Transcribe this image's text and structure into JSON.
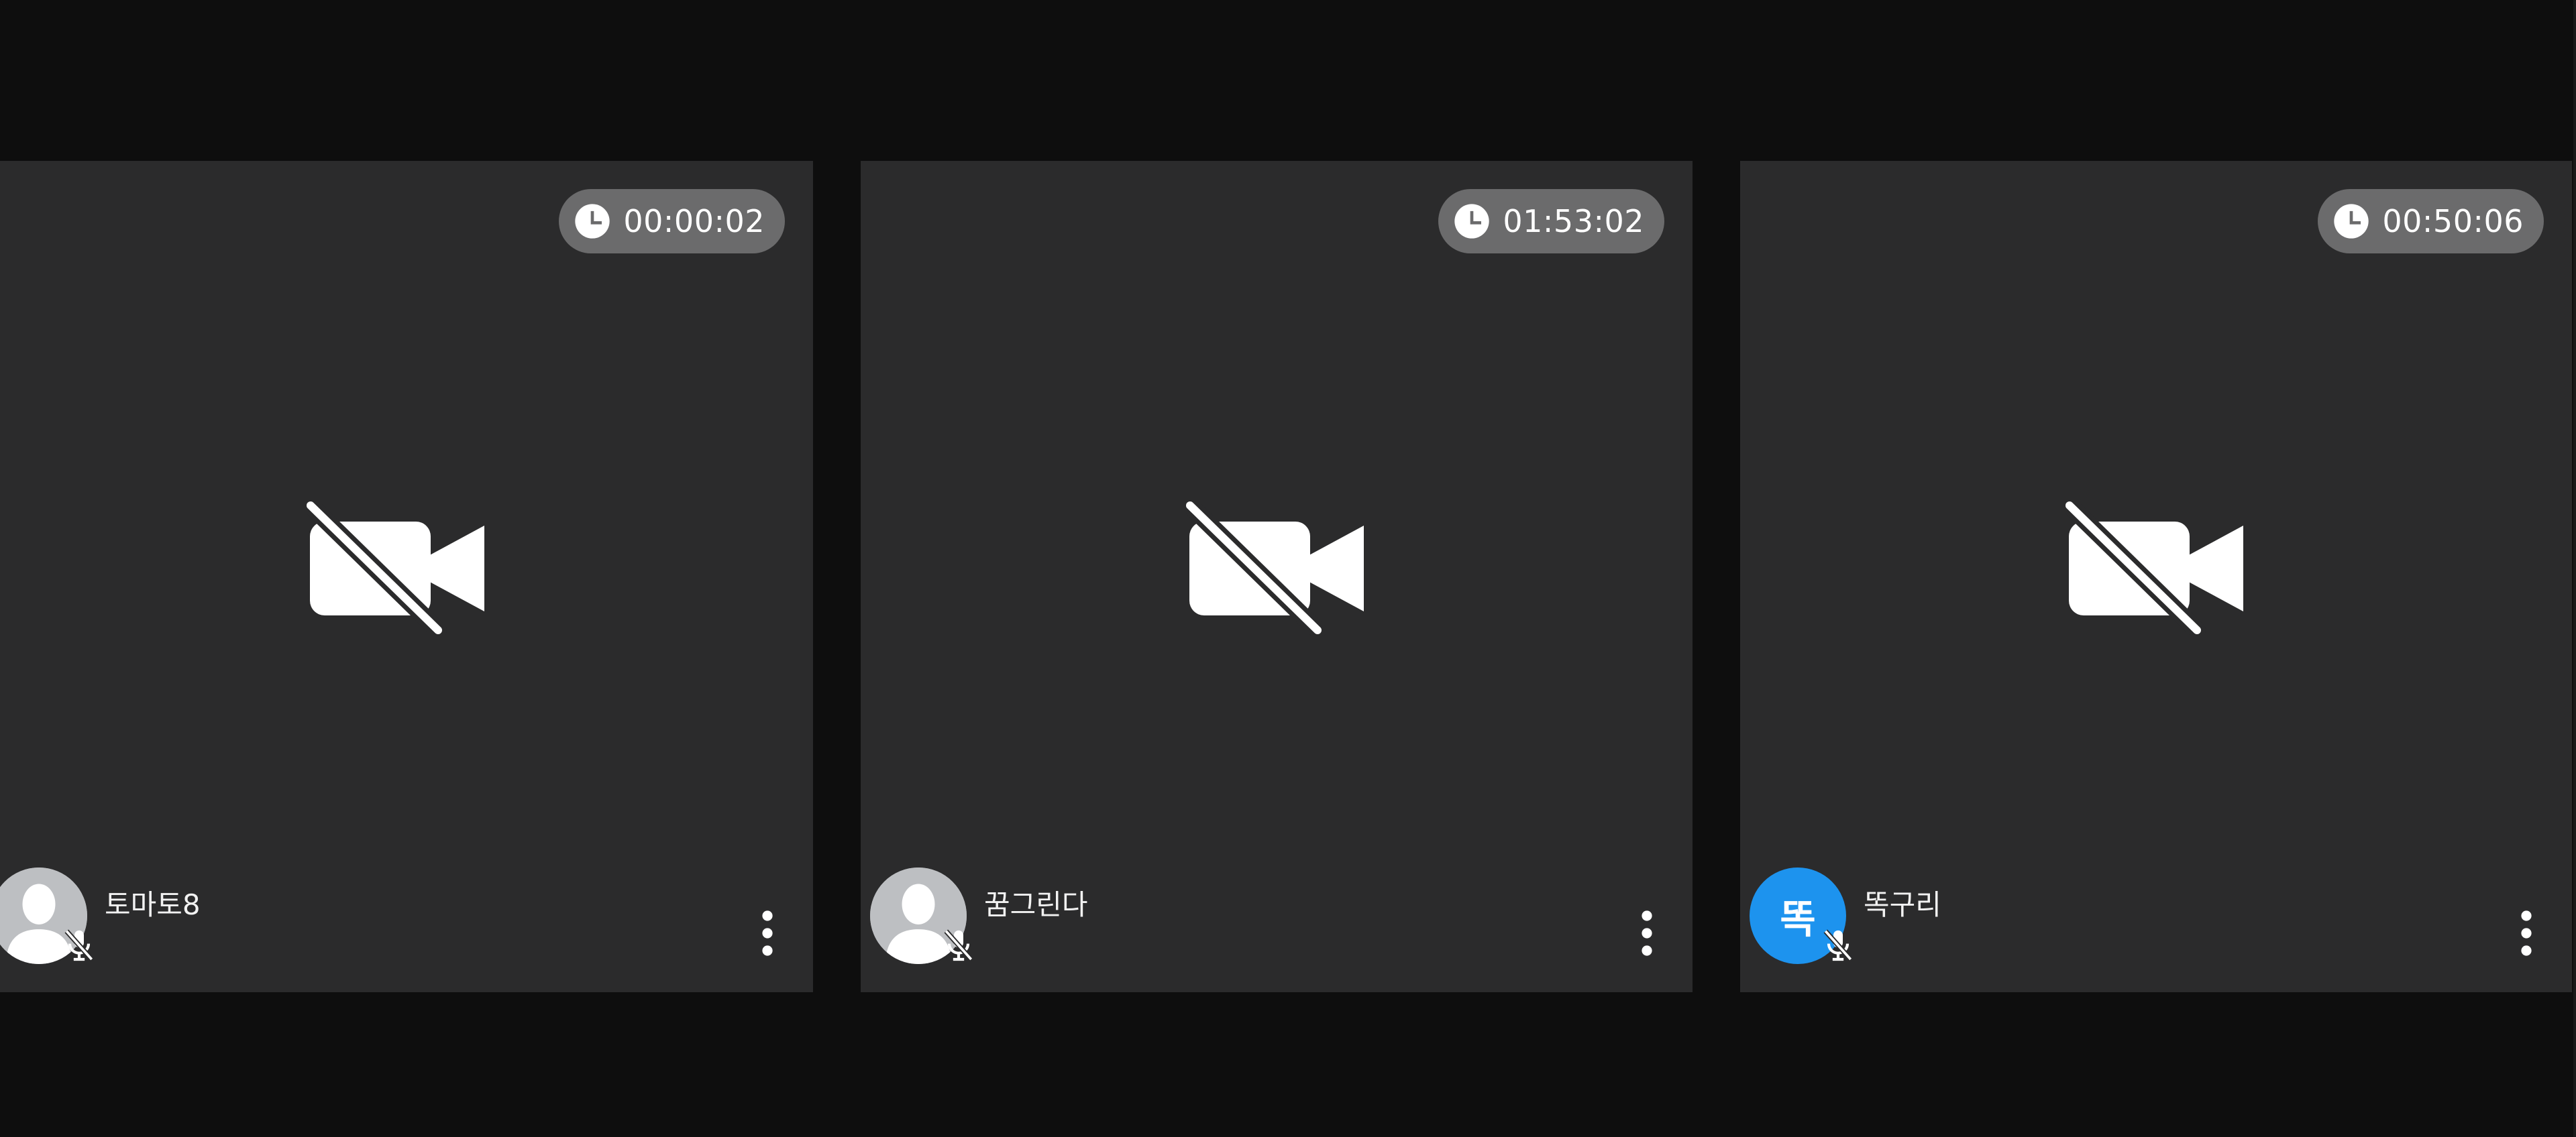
{
  "colors": {
    "background": "#0e0e0e",
    "tile": "#2b2b2c",
    "timer_pill": "#6b6b6c",
    "avatar_default": "#bdbfc2",
    "avatar_accent": "#1d93ee"
  },
  "icons": {
    "timer": "clock-icon",
    "camera": "video-off-icon",
    "mic": "mic-off-icon",
    "menu": "more-vertical-icon"
  },
  "participants": [
    {
      "name": "토마토8",
      "timer": "00:00:02",
      "avatar_type": "silhouette",
      "avatar_text": ""
    },
    {
      "name": "꿈그린다",
      "timer": "01:53:02",
      "avatar_type": "silhouette",
      "avatar_text": ""
    },
    {
      "name": "똑구리",
      "timer": "00:50:06",
      "avatar_type": "letter",
      "avatar_text": "똑"
    }
  ]
}
